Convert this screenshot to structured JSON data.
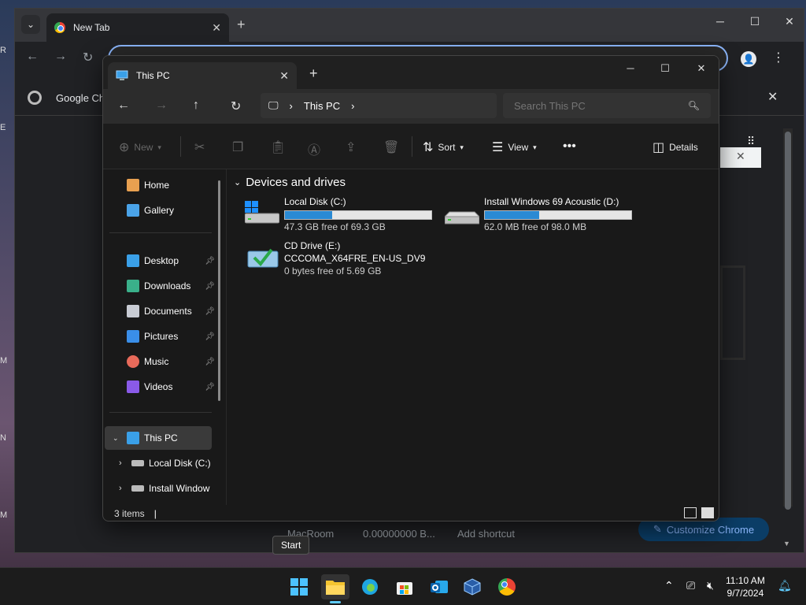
{
  "colors": {
    "accent": "#60cdff",
    "drive_bar_fill": "#2a8ad4",
    "folder_blue": "#1e90ff",
    "chrome_customize": "#8ab4f8"
  },
  "chrome": {
    "tab_title": "New Tab",
    "infobar_text": "Google Ch",
    "shortcuts": [
      "MacRoom",
      "0.00000000 B...",
      "Add shortcut"
    ],
    "customize_label": "Customize Chrome"
  },
  "explorer": {
    "tab_title": "This PC",
    "address_segment": "This PC",
    "search_placeholder": "Search This PC",
    "commands": {
      "new": "New",
      "sort": "Sort",
      "view": "View",
      "details": "Details"
    },
    "sidebar": {
      "top": [
        {
          "label": "Home",
          "icon": "home-icon"
        },
        {
          "label": "Gallery",
          "icon": "gallery-icon"
        }
      ],
      "pinned": [
        {
          "label": "Desktop",
          "icon": "desktop-folder-icon"
        },
        {
          "label": "Downloads",
          "icon": "downloads-folder-icon"
        },
        {
          "label": "Documents",
          "icon": "documents-folder-icon"
        },
        {
          "label": "Pictures",
          "icon": "pictures-folder-icon"
        },
        {
          "label": "Music",
          "icon": "music-folder-icon"
        },
        {
          "label": "Videos",
          "icon": "videos-folder-icon"
        }
      ],
      "tree": [
        {
          "label": "This PC",
          "icon": "computer-icon",
          "expanded": true,
          "selected": true
        },
        {
          "label": "Local Disk (C:)",
          "icon": "drive-icon"
        },
        {
          "label": "Install Window",
          "icon": "drive-icon"
        }
      ]
    },
    "group_title": "Devices and drives",
    "drives": [
      {
        "name": "Local Disk (C:)",
        "free_text": "47.3 GB free of 69.3 GB",
        "used_fraction": 0.32
      },
      {
        "name": "Install Windows 69 Acoustic (D:)",
        "free_text": "62.0 MB free of 98.0 MB",
        "used_fraction": 0.37
      },
      {
        "name": "CD Drive (E:)",
        "label": "CCCOMA_X64FRE_EN-US_DV9",
        "free_text": "0 bytes free of 5.69 GB"
      }
    ],
    "status": "3 items"
  },
  "tooltip": "Start",
  "taskbar": {
    "apps": [
      "start-icon",
      "file-explorer-icon",
      "edge-icon",
      "store-icon",
      "outlook-icon",
      "virtualbox-icon",
      "chrome-icon"
    ]
  },
  "clock": {
    "time": "11:10 AM",
    "date": "9/7/2024"
  },
  "desktop_edge": [
    "R",
    "E",
    "M",
    "N",
    "M"
  ]
}
